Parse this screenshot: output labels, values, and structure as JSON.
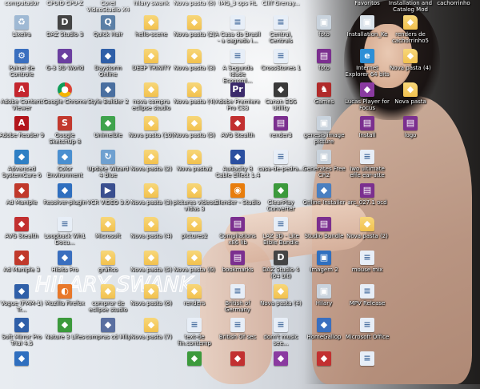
{
  "top_labels": [
    {
      "col": 0,
      "text": "computador"
    },
    {
      "col": 1,
      "text": "CPUID CPU-Z"
    },
    {
      "col": 2,
      "text": "Corel VideoStudio X4"
    },
    {
      "col": 3,
      "text": "hilary swank"
    },
    {
      "col": 4,
      "text": "Nova pasta (8)"
    },
    {
      "col": 5,
      "text": "IMG_3 ops HL"
    },
    {
      "col": 6,
      "text": "Cliff Grenay..."
    },
    {
      "col": 8,
      "text": "Favoritos"
    },
    {
      "col": 9,
      "text": "Installation and Catalog Mod"
    },
    {
      "col": 10,
      "text": "cachorrinho"
    }
  ],
  "icons": [
    {
      "col": 0,
      "row": 0,
      "label": "Lixeira",
      "icon": "recycle-bin-icon",
      "color": "#9fb9d4"
    },
    {
      "col": 1,
      "row": 0,
      "label": "DAZ Studio 3",
      "icon": "daz-studio-icon",
      "color": "#444444"
    },
    {
      "col": 2,
      "row": 0,
      "label": "Quick Hair",
      "icon": "quick-hair-icon",
      "color": "#5b7fa6"
    },
    {
      "col": 3,
      "row": 0,
      "label": "hello-scene",
      "icon": "folder-icon",
      "color": "#f2c14e"
    },
    {
      "col": 4,
      "row": 0,
      "label": "Nova pasta (2)",
      "icon": "folder-icon",
      "color": "#f2c14e"
    },
    {
      "col": 5,
      "row": 0,
      "label": "A Casa do Brasil - a sagrada i...",
      "icon": "document-icon",
      "color": "#e7eef7"
    },
    {
      "col": 6,
      "row": 0,
      "label": "Central, Centrais",
      "icon": "document-icon",
      "color": "#e7eef7"
    },
    {
      "col": 7,
      "row": 0,
      "label": "foto",
      "icon": "image-file-icon",
      "color": "#c9d3dd"
    },
    {
      "col": 8,
      "row": 0,
      "label": "Installation_Ke",
      "icon": "image-file-icon",
      "color": "#d9e2ea"
    },
    {
      "col": 9,
      "row": 0,
      "label": "renders de cachorrinho5",
      "icon": "folder-icon",
      "color": "#f2c14e"
    },
    {
      "col": 0,
      "row": 1,
      "label": "Painel de Controle",
      "icon": "control-panel-icon",
      "color": "#3a6fbf"
    },
    {
      "col": 1,
      "row": 1,
      "label": "G-3 3D World",
      "icon": "app-icon",
      "color": "#6b3fa0"
    },
    {
      "col": 2,
      "row": 1,
      "label": "Daystorm Online",
      "icon": "app-icon",
      "color": "#2f5fa8"
    },
    {
      "col": 3,
      "row": 1,
      "label": "DEEP TRINITY",
      "icon": "folder-icon",
      "color": "#f2c14e"
    },
    {
      "col": 4,
      "row": 1,
      "label": "Nova pasta (3)",
      "icon": "folder-icon",
      "color": "#f2c14e"
    },
    {
      "col": 5,
      "row": 1,
      "label": "A Segunda Idade Economi...",
      "icon": "document-icon",
      "color": "#e7eef7"
    },
    {
      "col": 6,
      "row": 1,
      "label": "CrossStones 1",
      "icon": "document-icon",
      "color": "#e7eef7"
    },
    {
      "col": 7,
      "row": 1,
      "label": "foto",
      "icon": "winrar-archive-icon",
      "color": "#7b2f8f"
    },
    {
      "col": 8,
      "row": 1,
      "label": "Internet Explorer 64 bits",
      "icon": "internet-explorer-icon",
      "color": "#2d8fd6"
    },
    {
      "col": 9,
      "row": 1,
      "label": "Nova pasta (4)",
      "icon": "folder-icon",
      "color": "#f2c14e"
    },
    {
      "col": 0,
      "row": 2,
      "label": "Adobe Content Viewer",
      "icon": "adobe-icon",
      "color": "#c4262e"
    },
    {
      "col": 1,
      "row": 2,
      "label": "Google Chrome",
      "icon": "chrome-icon",
      "color": "#e0b43a"
    },
    {
      "col": 2,
      "row": 2,
      "label": "Style Builder 2",
      "icon": "app-icon",
      "color": "#4a6fa0"
    },
    {
      "col": 3,
      "row": 2,
      "label": "nova compra eclipse studio",
      "icon": "folder-icon",
      "color": "#f2c14e"
    },
    {
      "col": 4,
      "row": 2,
      "label": "Nova pasta (4)",
      "icon": "folder-icon",
      "color": "#f2c14e"
    },
    {
      "col": 5,
      "row": 2,
      "label": "Adobe Premiere Pro CS3",
      "icon": "adobe-premiere-icon",
      "color": "#3b2a6b"
    },
    {
      "col": 6,
      "row": 2,
      "label": "Canon EOS Utility",
      "icon": "app-icon",
      "color": "#3a3a3a"
    },
    {
      "col": 7,
      "row": 2,
      "label": "Games",
      "icon": "games-icon",
      "color": "#b02a2a"
    },
    {
      "col": 8,
      "row": 2,
      "label": "Lucas Player for Focus",
      "icon": "app-icon",
      "color": "#8a3aa0"
    },
    {
      "col": 9,
      "row": 2,
      "label": "Nova pasta",
      "icon": "folder-icon",
      "color": "#f2c14e"
    },
    {
      "col": 0,
      "row": 3,
      "label": "Adobe Reader 9",
      "icon": "adobe-reader-icon",
      "color": "#b3151c"
    },
    {
      "col": 1,
      "row": 3,
      "label": "Google SketchUp 8",
      "icon": "sketchup-icon",
      "color": "#c2392e"
    },
    {
      "col": 2,
      "row": 3,
      "label": "Unimelble",
      "icon": "app-icon",
      "color": "#3fa34d"
    },
    {
      "col": 3,
      "row": 3,
      "label": "Nova pasta (10)",
      "icon": "folder-icon",
      "color": "#f2c14e"
    },
    {
      "col": 4,
      "row": 3,
      "label": "Nova pasta (5)",
      "icon": "folder-icon",
      "color": "#f2c14e"
    },
    {
      "col": 5,
      "row": 3,
      "label": "AVG Stealth",
      "icon": "app-icon",
      "color": "#c23030"
    },
    {
      "col": 6,
      "row": 3,
      "label": "render3",
      "icon": "winrar-archive-icon",
      "color": "#7b2f8f"
    },
    {
      "col": 7,
      "row": 3,
      "label": "genesis image picture",
      "icon": "image-file-icon",
      "color": "#c9d3dd"
    },
    {
      "col": 8,
      "row": 3,
      "label": "Install",
      "icon": "winrar-archive-icon",
      "color": "#7b2f8f"
    },
    {
      "col": 9,
      "row": 3,
      "label": "logo",
      "icon": "winrar-archive-icon",
      "color": "#7b2f8f"
    },
    {
      "col": 0,
      "row": 4,
      "label": "Advanced SystemCare 6",
      "icon": "app-icon",
      "color": "#2e7fc4"
    },
    {
      "col": 1,
      "row": 4,
      "label": "Color Environment",
      "icon": "app-icon",
      "color": "#4a8fd0"
    },
    {
      "col": 2,
      "row": 4,
      "label": "Update Wizard 4 Blue",
      "icon": "update-icon",
      "color": "#6fa0d0"
    },
    {
      "col": 3,
      "row": 4,
      "label": "Nova pasta (2)",
      "icon": "folder-icon",
      "color": "#f2c14e"
    },
    {
      "col": 4,
      "row": 4,
      "label": "Nova pasta2",
      "icon": "folder-icon",
      "color": "#f2c14e"
    },
    {
      "col": 5,
      "row": 4,
      "label": "Audacity 8 Cable Effect 1.4",
      "icon": "app-icon",
      "color": "#2b4fa0"
    },
    {
      "col": 6,
      "row": 4,
      "label": "casa-de-pedra...",
      "icon": "document-icon",
      "color": "#e7eef7"
    },
    {
      "col": 7,
      "row": 4,
      "label": "Generates Free CR2",
      "icon": "image-file-icon",
      "color": "#c9d3dd"
    },
    {
      "col": 8,
      "row": 4,
      "label": "Iwo ultimate effe ear-atte",
      "icon": "document-icon",
      "color": "#e7eef7"
    },
    {
      "col": 0,
      "row": 5,
      "label": "Ad Maniple",
      "icon": "app-icon",
      "color": "#c0392b"
    },
    {
      "col": 1,
      "row": 5,
      "label": "Resolver-plugin",
      "icon": "app-icon",
      "color": "#2f6fbf"
    },
    {
      "col": 2,
      "row": 5,
      "label": "VCR VIDEO 3.0",
      "icon": "video-icon",
      "color": "#3a4f8f"
    },
    {
      "col": 3,
      "row": 5,
      "label": "Nova pasta (3)",
      "icon": "folder-icon",
      "color": "#f2c14e"
    },
    {
      "col": 4,
      "row": 5,
      "label": "pictures videos vidas 3",
      "icon": "folder-icon",
      "color": "#f2c14e"
    },
    {
      "col": 5,
      "row": 5,
      "label": "Blender - Studio",
      "icon": "blender-icon",
      "color": "#e87d0d"
    },
    {
      "col": 6,
      "row": 5,
      "label": "ClearPlay Converter",
      "icon": "app-icon",
      "color": "#3c9a3c"
    },
    {
      "col": 7,
      "row": 5,
      "label": "Online Installer",
      "icon": "app-icon",
      "color": "#4a7fc0"
    },
    {
      "col": 8,
      "row": 5,
      "label": "arc_027.1 ocd",
      "icon": "winrar-archive-icon",
      "color": "#7b2f8f"
    },
    {
      "col": 0,
      "row": 6,
      "label": "AVG Stealth",
      "icon": "app-icon",
      "color": "#c23030"
    },
    {
      "col": 1,
      "row": 6,
      "label": "Loopback Wh1 Docu...",
      "icon": "document-icon",
      "color": "#e7eef7"
    },
    {
      "col": 2,
      "row": 6,
      "label": "Microsoft",
      "icon": "folder-icon",
      "color": "#f2c14e"
    },
    {
      "col": 3,
      "row": 6,
      "label": "Nova pasta (4)",
      "icon": "folder-icon",
      "color": "#f2c14e"
    },
    {
      "col": 4,
      "row": 6,
      "label": "pictures2",
      "icon": "folder-icon",
      "color": "#f2c14e"
    },
    {
      "col": 5,
      "row": 6,
      "label": "Compilations x86 lib",
      "icon": "winrar-archive-icon",
      "color": "#7b2f8f"
    },
    {
      "col": 6,
      "row": 6,
      "label": "LAZ 3D - Lite Bible Bundle",
      "icon": "document-icon",
      "color": "#e7eef7"
    },
    {
      "col": 7,
      "row": 6,
      "label": "Studio Bundle",
      "icon": "winrar-archive-icon",
      "color": "#7b2f8f"
    },
    {
      "col": 8,
      "row": 6,
      "label": "Nova pasta (2)",
      "icon": "folder-icon",
      "color": "#f2c14e"
    },
    {
      "col": 0,
      "row": 7,
      "label": "Ad Maniple 3",
      "icon": "app-icon",
      "color": "#c0392b"
    },
    {
      "col": 1,
      "row": 7,
      "label": "Hibits Pro",
      "icon": "app-icon",
      "color": "#3a6fbf"
    },
    {
      "col": 2,
      "row": 7,
      "label": "gráfico",
      "icon": "folder-icon",
      "color": "#f2c14e"
    },
    {
      "col": 3,
      "row": 7,
      "label": "Nova pasta (5)",
      "icon": "folder-icon",
      "color": "#f2c14e"
    },
    {
      "col": 4,
      "row": 7,
      "label": "Nova pasta (6)",
      "icon": "folder-icon",
      "color": "#f2c14e"
    },
    {
      "col": 5,
      "row": 7,
      "label": "bookmarks",
      "icon": "winrar-archive-icon",
      "color": "#7b2f8f"
    },
    {
      "col": 6,
      "row": 7,
      "label": "DAZ Studio 4 (64 bit)",
      "icon": "daz-studio-icon",
      "color": "#444444"
    },
    {
      "col": 7,
      "row": 7,
      "label": "Imagem 2",
      "icon": "image-file-icon",
      "color": "#2f6fbf"
    },
    {
      "col": 8,
      "row": 7,
      "label": "mouse mix",
      "icon": "document-icon",
      "color": "#e7eef7"
    },
    {
      "col": 0,
      "row": 8,
      "label": "Vogue (FMM-1) Tr...",
      "icon": "app-icon",
      "color": "#2f5fa8"
    },
    {
      "col": 1,
      "row": 8,
      "label": "Mozilla Firefox",
      "icon": "firefox-icon",
      "color": "#e8782a"
    },
    {
      "col": 2,
      "row": 8,
      "label": "comprar de eclipse studio",
      "icon": "folder-icon",
      "color": "#f2c14e"
    },
    {
      "col": 3,
      "row": 8,
      "label": "Nova pasta (6)",
      "icon": "folder-icon",
      "color": "#f2c14e"
    },
    {
      "col": 4,
      "row": 8,
      "label": "renders",
      "icon": "folder-icon",
      "color": "#f2c14e"
    },
    {
      "col": 5,
      "row": 8,
      "label": "British of Germany",
      "icon": "document-icon",
      "color": "#e7eef7"
    },
    {
      "col": 6,
      "row": 8,
      "label": "Nova pasta (4)",
      "icon": "folder-icon",
      "color": "#f2c14e"
    },
    {
      "col": 7,
      "row": 8,
      "label": "Hilary",
      "icon": "image-file-icon",
      "color": "#c9d3dd"
    },
    {
      "col": 8,
      "row": 8,
      "label": "MPV Release",
      "icon": "document-icon",
      "color": "#e7eef7"
    },
    {
      "col": 0,
      "row": 9,
      "label": "Soft Mirror Pro Trial 4.5",
      "icon": "app-icon",
      "color": "#2f5fa8"
    },
    {
      "col": 1,
      "row": 9,
      "label": "Nature 3 Lifes",
      "icon": "app-icon",
      "color": "#3c9a3c"
    },
    {
      "col": 2,
      "row": 9,
      "label": "compras cd Mily",
      "icon": "app-icon",
      "color": "#5a6fa0"
    },
    {
      "col": 3,
      "row": 9,
      "label": "Nova pasta (7)",
      "icon": "folder-icon",
      "color": "#f2c14e"
    },
    {
      "col": 4,
      "row": 9,
      "label": "text-de fin.contemp",
      "icon": "document-icon",
      "color": "#e7eef7"
    },
    {
      "col": 5,
      "row": 9,
      "label": "British Of sec",
      "icon": "document-icon",
      "color": "#e7eef7"
    },
    {
      "col": 6,
      "row": 9,
      "label": "dom't music see...",
      "icon": "document-icon",
      "color": "#e7eef7"
    },
    {
      "col": 7,
      "row": 9,
      "label": "HomeGallop",
      "icon": "app-icon",
      "color": "#3a6fbf"
    },
    {
      "col": 8,
      "row": 9,
      "label": "Microsoft Office",
      "icon": "document-icon",
      "color": "#e7eef7"
    },
    {
      "col": 0,
      "row": 10,
      "label": "",
      "icon": "app-icon",
      "color": "#2f6fbf"
    },
    {
      "col": 4,
      "row": 10,
      "label": "",
      "icon": "app-icon",
      "color": "#3c9a3c"
    },
    {
      "col": 5,
      "row": 10,
      "label": "",
      "icon": "app-icon",
      "color": "#c23030"
    },
    {
      "col": 6,
      "row": 10,
      "label": "",
      "icon": "app-icon",
      "color": "#8a3aa0"
    },
    {
      "col": 7,
      "row": 10,
      "label": "",
      "icon": "app-icon",
      "color": "#c23030"
    },
    {
      "col": 8,
      "row": 10,
      "label": "",
      "icon": "document-icon",
      "color": "#e7eef7"
    }
  ],
  "signature": "HILARY SWANK"
}
